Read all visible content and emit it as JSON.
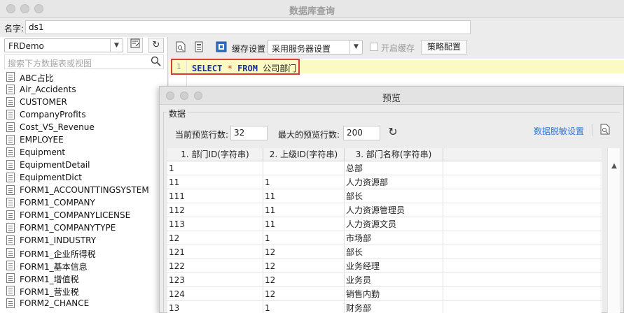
{
  "window": {
    "title": "数据库查询"
  },
  "name_row": {
    "label": "名字:",
    "value": "ds1"
  },
  "left_panel": {
    "datasource": "FRDemo",
    "search_placeholder": "搜索下方数据表或视图",
    "tables": [
      "ABC占比",
      "Air_Accidents",
      "CUSTOMER",
      "CompanyProfits",
      "Cost_VS_Revenue",
      "EMPLOYEE",
      "Equipment",
      "EquipmentDetail",
      "EquipmentDict",
      "FORM1_ACCOUNTTINGSYSTEM",
      "FORM1_COMPANY",
      "FORM1_COMPANYLICENSE",
      "FORM1_COMPANYTYPE",
      "FORM1_INDUSTRY",
      "FORM1_企业所得税",
      "FORM1_基本信息",
      "FORM1_增值税",
      "FORM1_营业税",
      "FORM2_CHANCE"
    ]
  },
  "toolbar": {
    "cache_label": "缓存设置",
    "cache_value": "采用服务器设置",
    "enable_cache_label": "开启缓存",
    "policy_button": "策略配置"
  },
  "editor": {
    "line_number": "1",
    "kw_select": "SELECT",
    "star": "*",
    "kw_from": "FROM",
    "table_name": "公司部门"
  },
  "preview": {
    "title": "预览",
    "group_label": "数据",
    "current_rows_label": "当前预览行数:",
    "current_rows_value": "32",
    "max_rows_label": "最大的预览行数:",
    "max_rows_value": "200",
    "mask_link": "数据脱敏设置",
    "columns": [
      "1. 部门ID(字符串)",
      "2. 上级ID(字符串)",
      "3. 部门名称(字符串)"
    ],
    "rows": [
      [
        "1",
        "",
        "总部"
      ],
      [
        "11",
        "1",
        "人力资源部"
      ],
      [
        "111",
        "11",
        "部长"
      ],
      [
        "112",
        "11",
        "人力资源管理员"
      ],
      [
        "113",
        "11",
        "人力资源文员"
      ],
      [
        "12",
        "1",
        "市场部"
      ],
      [
        "121",
        "12",
        "部长"
      ],
      [
        "122",
        "12",
        "业务经理"
      ],
      [
        "123",
        "12",
        "业务员"
      ],
      [
        "124",
        "12",
        "销售内勤"
      ],
      [
        "13",
        "1",
        "财务部"
      ]
    ]
  }
}
